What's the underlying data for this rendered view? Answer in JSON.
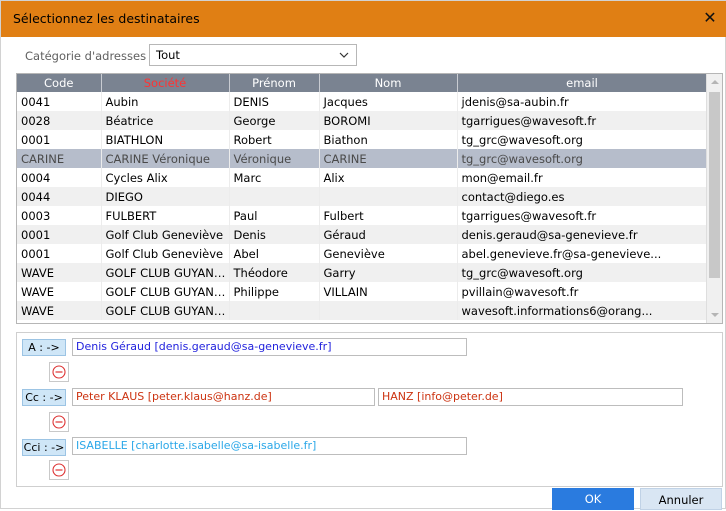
{
  "window": {
    "title": "Sélectionnez les destinataires",
    "close": "✕"
  },
  "category": {
    "label": "Catégorie d'adresses",
    "value": "Tout"
  },
  "table": {
    "headers": [
      "Code",
      "Société",
      "Prénom",
      "Nom",
      "email"
    ],
    "sorted_column": "Société",
    "rows": [
      [
        "0041",
        "Aubin",
        "DENIS",
        "Jacques",
        "jdenis@sa-aubin.fr"
      ],
      [
        "0028",
        "Béatrice",
        "George",
        "BOROMI",
        "tgarrigues@wavesoft.fr"
      ],
      [
        "0001",
        "BIATHLON",
        "Robert",
        "Biathon",
        "tg_grc@wavesoft.org"
      ],
      [
        "CARINE",
        "CARINE Véronique",
        "Véronique",
        "CARINE",
        "tg_grc@wavesoft.org"
      ],
      [
        "0004",
        "Cycles Alix",
        "Marc",
        "Alix",
        "mon@email.fr"
      ],
      [
        "0044",
        "DIEGO",
        "",
        "",
        "contact@diego.es"
      ],
      [
        "0003",
        "FULBERT",
        "Paul",
        "Fulbert",
        "tgarrigues@wavesoft.fr"
      ],
      [
        "0001",
        "Golf Club Geneviève",
        "Denis",
        "Géraud",
        "denis.geraud@sa-genevieve.fr"
      ],
      [
        "0001",
        "Golf Club Geneviève",
        "Abel",
        "Geneviève",
        "abel.genevieve.fr@sa-genevieve..."
      ],
      [
        "WAVE",
        "GOLF CLUB GUYANC...",
        "Théodore",
        "Garry",
        "tg_grc@wavesoft.org"
      ],
      [
        "WAVE",
        "GOLF CLUB GUYANC...",
        "Philippe",
        "VILLAIN",
        "pvillain@wavesoft.fr"
      ],
      [
        "WAVE",
        "GOLF CLUB GUYANC...",
        "",
        "",
        "wavesoft.informations6@orang..."
      ]
    ],
    "selected_row_index": 3
  },
  "recipients": {
    "to": {
      "button": "A : ->",
      "values": [
        "Denis Géraud [denis.geraud@sa-genevieve.fr]"
      ]
    },
    "cc": {
      "button": "Cc : ->",
      "values": [
        "Peter KLAUS [peter.klaus@hanz.de]",
        "HANZ [info@peter.de]"
      ]
    },
    "bcc": {
      "button": "Cci : ->",
      "values": [
        "ISABELLE [charlotte.isabelle@sa-isabelle.fr]"
      ]
    }
  },
  "buttons": {
    "ok": "OK",
    "cancel": "Annuler"
  },
  "colors": {
    "titlebar": "#e07f14",
    "header": "#7a8391",
    "selected_row": "#b6bdcb",
    "ok": "#2a7bdf"
  },
  "icons": {
    "close": "close-icon",
    "chevron": "chevron-down-icon",
    "remove": "remove-circle-icon"
  }
}
